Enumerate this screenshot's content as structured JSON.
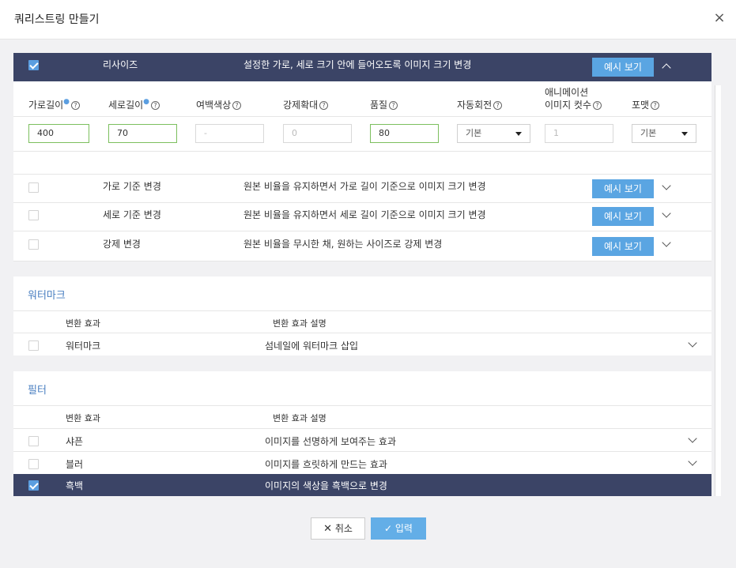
{
  "dialog": {
    "title": "쿼리스트링 만들기",
    "close_icon": "×"
  },
  "resize": {
    "main": {
      "label": "리사이즈",
      "desc": "설정한 가로, 세로 크기 안에 들어오도록 이미지 크기 변경",
      "example": "예시 보기",
      "checked": true
    },
    "fields": {
      "width": {
        "label": "가로길이",
        "value": "400"
      },
      "height": {
        "label": "세로길이",
        "value": "70"
      },
      "margin_color": {
        "label": "여백색상",
        "placeholder": "-"
      },
      "force_enlarge": {
        "label": "강제확대",
        "placeholder": "0"
      },
      "quality": {
        "label": "품질",
        "value": "80"
      },
      "auto_rotate": {
        "label": "자동회전",
        "value": "기본"
      },
      "anim_frames": {
        "label_line1": "애니메이션",
        "label_line2": "이미지 컷수",
        "placeholder": "1"
      },
      "format": {
        "label": "포맷",
        "value": "기본"
      }
    },
    "options": [
      {
        "label": "가로 기준 변경",
        "desc": "원본 비율을 유지하면서 가로 길이 기준으로 이미지 크기 변경",
        "example": "예시 보기"
      },
      {
        "label": "세로 기준 변경",
        "desc": "원본 비율을 유지하면서 세로 길이 기준으로 이미지 크기 변경",
        "example": "예시 보기"
      },
      {
        "label": "강제 변경",
        "desc": "원본 비율을 무시한 채, 원하는 사이즈로 강제 변경",
        "example": "예시 보기"
      }
    ]
  },
  "watermark": {
    "title": "워터마크",
    "col_effect": "변환 효과",
    "col_desc": "변환 효과 설명",
    "rows": [
      {
        "label": "워터마크",
        "desc": "섬네일에 워터마크 삽입"
      }
    ]
  },
  "filter": {
    "title": "필터",
    "col_effect": "변환 효과",
    "col_desc": "변환 효과 설명",
    "rows": [
      {
        "label": "샤픈",
        "desc": "이미지를 선명하게 보여주는 효과"
      },
      {
        "label": "블러",
        "desc": "이미지를 흐릿하게 만드는 효과"
      },
      {
        "label": "흑백",
        "desc": "이미지의 색상을 흑백으로 변경",
        "checked": true
      }
    ]
  },
  "footer": {
    "cancel": "취소",
    "submit": "입력"
  },
  "colors": {
    "navy": "#3b4466",
    "accent": "#5aa5e2",
    "section_title": "#4a7fc1",
    "valid_border": "#7cbf5e"
  }
}
